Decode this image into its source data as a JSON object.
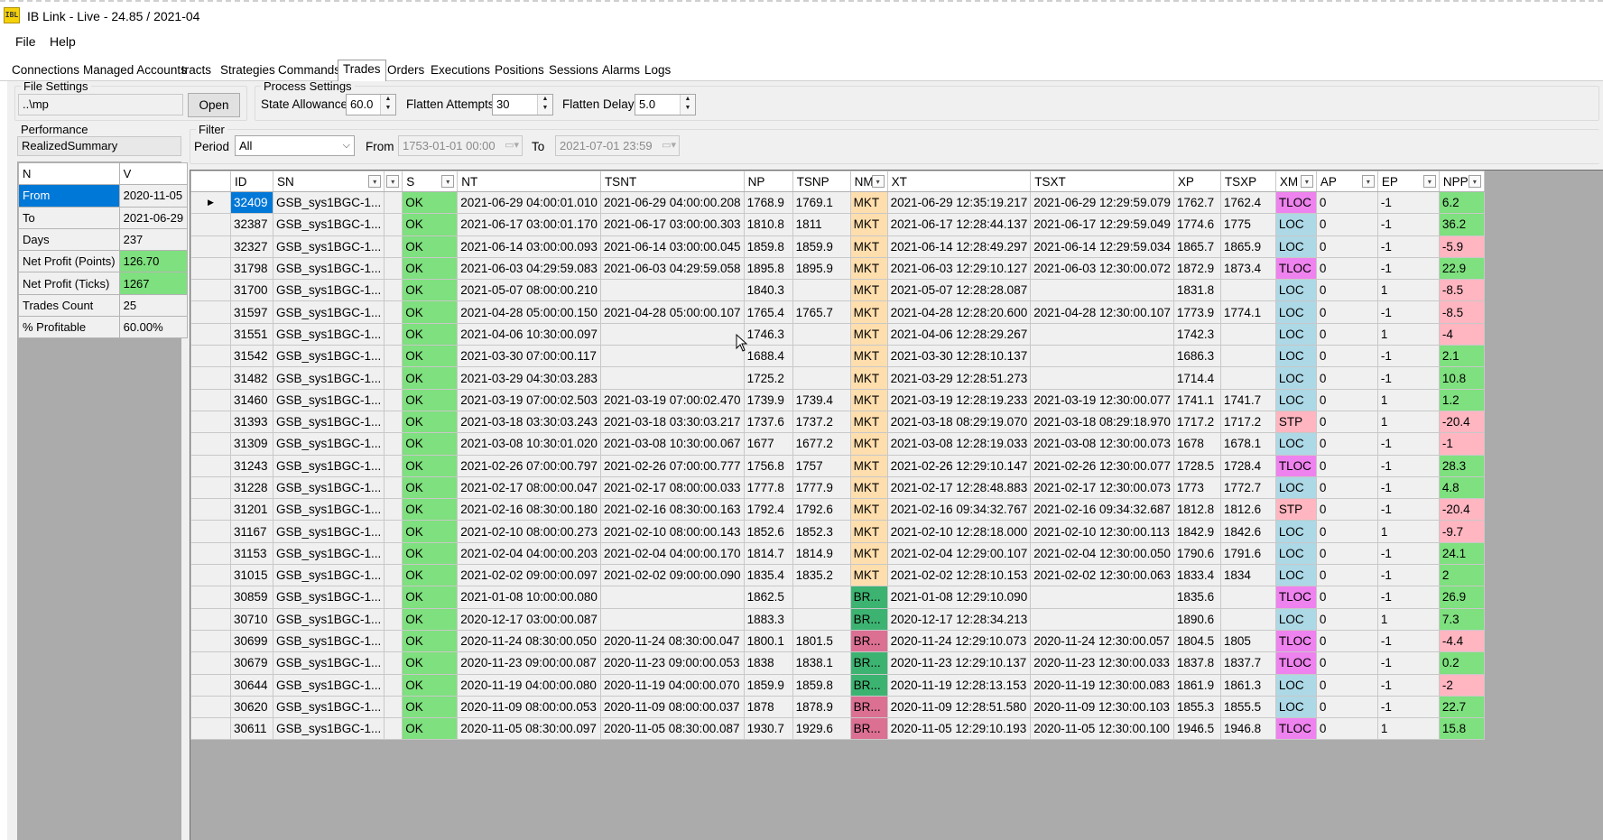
{
  "window": {
    "title": "IB Link - Live - 24.85 / 2021-04",
    "icon_text": "IBL"
  },
  "menu": [
    "File",
    "Help"
  ],
  "tabs": [
    "Connections",
    "Managed Accounts",
    "tracts",
    "Strategies",
    "Commands",
    "Trades",
    "Orders",
    "Executions",
    "Positions",
    "Sessions",
    "Alarms",
    "Logs"
  ],
  "selected_tab": "Trades",
  "file_settings": {
    "legend": "File Settings",
    "path": "..\\mp",
    "open_label": "Open"
  },
  "process_settings": {
    "legend": "Process Settings",
    "state_allowance_label": "State Allowance",
    "state_allowance": "60.0",
    "flatten_attempts_label": "Flatten Attempts",
    "flatten_attempts": "30",
    "flatten_delay_label": "Flatten Delay",
    "flatten_delay": "5.0"
  },
  "performance": {
    "legend": "Performance",
    "selector": "RealizedSummary",
    "headers": [
      "N",
      "V"
    ],
    "rows": [
      {
        "k": "From",
        "v": "2020-11-05"
      },
      {
        "k": "To",
        "v": "2021-06-29"
      },
      {
        "k": "Days",
        "v": "237"
      },
      {
        "k": "Net Profit (Points)",
        "v": "126.70"
      },
      {
        "k": "Net Profit (Ticks)",
        "v": "1267"
      },
      {
        "k": "Trades Count",
        "v": "25"
      },
      {
        "k": "% Profitable",
        "v": "60.00%"
      }
    ]
  },
  "filter": {
    "legend": "Filter",
    "period_label": "Period",
    "period_value": "All",
    "from_label": "From",
    "from_value": "1753-01-01 00:00",
    "to_label": "To",
    "to_value": "2021-07-01 23:59"
  },
  "grid": {
    "columns": [
      "ID",
      "SN",
      "",
      "S",
      "NT",
      "TSNT",
      "NP",
      "TSNP",
      "NM",
      "XT",
      "TSXT",
      "XP",
      "TSXP",
      "XM",
      "AP",
      "EP",
      "NPP"
    ],
    "rows": [
      [
        "32409",
        "GSB_sys1BGC-1...",
        "",
        "OK",
        "2021-06-29 04:00:01.010",
        "2021-06-29 04:00:00.208",
        "1768.9",
        "1769.1",
        "MKT",
        "2021-06-29 12:35:19.217",
        "2021-06-29 12:29:59.079",
        "1762.7",
        "1762.4",
        "TLOC",
        "0",
        "-1",
        "6.2"
      ],
      [
        "32387",
        "GSB_sys1BGC-1...",
        "",
        "OK",
        "2021-06-17 03:00:01.170",
        "2021-06-17 03:00:00.303",
        "1810.8",
        "1811",
        "MKT",
        "2021-06-17 12:28:44.137",
        "2021-06-17 12:29:59.049",
        "1774.6",
        "1775",
        "LOC",
        "0",
        "-1",
        "36.2"
      ],
      [
        "32327",
        "GSB_sys1BGC-1...",
        "",
        "OK",
        "2021-06-14 03:00:00.093",
        "2021-06-14 03:00:00.045",
        "1859.8",
        "1859.9",
        "MKT",
        "2021-06-14 12:28:49.297",
        "2021-06-14 12:29:59.034",
        "1865.7",
        "1865.9",
        "LOC",
        "0",
        "-1",
        "-5.9"
      ],
      [
        "31798",
        "GSB_sys1BGC-1...",
        "",
        "OK",
        "2021-06-03 04:29:59.083",
        "2021-06-03 04:29:59.058",
        "1895.8",
        "1895.9",
        "MKT",
        "2021-06-03 12:29:10.127",
        "2021-06-03 12:30:00.072",
        "1872.9",
        "1873.4",
        "TLOC",
        "0",
        "-1",
        "22.9"
      ],
      [
        "31700",
        "GSB_sys1BGC-1...",
        "",
        "OK",
        "2021-05-07 08:00:00.210",
        "",
        "1840.3",
        "",
        "MKT",
        "2021-05-07 12:28:28.087",
        "",
        "1831.8",
        "",
        "LOC",
        "0",
        "1",
        "-8.5"
      ],
      [
        "31597",
        "GSB_sys1BGC-1...",
        "",
        "OK",
        "2021-04-28 05:00:00.150",
        "2021-04-28 05:00:00.107",
        "1765.4",
        "1765.7",
        "MKT",
        "2021-04-28 12:28:20.600",
        "2021-04-28 12:30:00.107",
        "1773.9",
        "1774.1",
        "LOC",
        "0",
        "-1",
        "-8.5"
      ],
      [
        "31551",
        "GSB_sys1BGC-1...",
        "",
        "OK",
        "2021-04-06 10:30:00.097",
        "",
        "1746.3",
        "",
        "MKT",
        "2021-04-06 12:28:29.267",
        "",
        "1742.3",
        "",
        "LOC",
        "0",
        "1",
        "-4"
      ],
      [
        "31542",
        "GSB_sys1BGC-1...",
        "",
        "OK",
        "2021-03-30 07:00:00.117",
        "",
        "1688.4",
        "",
        "MKT",
        "2021-03-30 12:28:10.137",
        "",
        "1686.3",
        "",
        "LOC",
        "0",
        "-1",
        "2.1"
      ],
      [
        "31482",
        "GSB_sys1BGC-1...",
        "",
        "OK",
        "2021-03-29 04:30:03.283",
        "",
        "1725.2",
        "",
        "MKT",
        "2021-03-29 12:28:51.273",
        "",
        "1714.4",
        "",
        "LOC",
        "0",
        "-1",
        "10.8"
      ],
      [
        "31460",
        "GSB_sys1BGC-1...",
        "",
        "OK",
        "2021-03-19 07:00:02.503",
        "2021-03-19 07:00:02.470",
        "1739.9",
        "1739.4",
        "MKT",
        "2021-03-19 12:28:19.233",
        "2021-03-19 12:30:00.077",
        "1741.1",
        "1741.7",
        "LOC",
        "0",
        "1",
        "1.2"
      ],
      [
        "31393",
        "GSB_sys1BGC-1...",
        "",
        "OK",
        "2021-03-18 03:30:03.243",
        "2021-03-18 03:30:03.217",
        "1737.6",
        "1737.2",
        "MKT",
        "2021-03-18 08:29:19.070",
        "2021-03-18 08:29:18.970",
        "1717.2",
        "1717.2",
        "STP",
        "0",
        "1",
        "-20.4"
      ],
      [
        "31309",
        "GSB_sys1BGC-1...",
        "",
        "OK",
        "2021-03-08 10:30:01.020",
        "2021-03-08 10:30:00.067",
        "1677",
        "1677.2",
        "MKT",
        "2021-03-08 12:28:19.033",
        "2021-03-08 12:30:00.073",
        "1678",
        "1678.1",
        "LOC",
        "0",
        "-1",
        "-1"
      ],
      [
        "31243",
        "GSB_sys1BGC-1...",
        "",
        "OK",
        "2021-02-26 07:00:00.797",
        "2021-02-26 07:00:00.777",
        "1756.8",
        "1757",
        "MKT",
        "2021-02-26 12:29:10.147",
        "2021-02-26 12:30:00.077",
        "1728.5",
        "1728.4",
        "TLOC",
        "0",
        "-1",
        "28.3"
      ],
      [
        "31228",
        "GSB_sys1BGC-1...",
        "",
        "OK",
        "2021-02-17 08:00:00.047",
        "2021-02-17 08:00:00.033",
        "1777.8",
        "1777.9",
        "MKT",
        "2021-02-17 12:28:48.883",
        "2021-02-17 12:30:00.073",
        "1773",
        "1772.7",
        "LOC",
        "0",
        "-1",
        "4.8"
      ],
      [
        "31201",
        "GSB_sys1BGC-1...",
        "",
        "OK",
        "2021-02-16 08:30:00.180",
        "2021-02-16 08:30:00.163",
        "1792.4",
        "1792.6",
        "MKT",
        "2021-02-16 09:34:32.767",
        "2021-02-16 09:34:32.687",
        "1812.8",
        "1812.6",
        "STP",
        "0",
        "-1",
        "-20.4"
      ],
      [
        "31167",
        "GSB_sys1BGC-1...",
        "",
        "OK",
        "2021-02-10 08:00:00.273",
        "2021-02-10 08:00:00.143",
        "1852.6",
        "1852.3",
        "MKT",
        "2021-02-10 12:28:18.000",
        "2021-02-10 12:30:00.113",
        "1842.9",
        "1842.6",
        "LOC",
        "0",
        "1",
        "-9.7"
      ],
      [
        "31153",
        "GSB_sys1BGC-1...",
        "",
        "OK",
        "2021-02-04 04:00:00.203",
        "2021-02-04 04:00:00.170",
        "1814.7",
        "1814.9",
        "MKT",
        "2021-02-04 12:29:00.107",
        "2021-02-04 12:30:00.050",
        "1790.6",
        "1791.6",
        "LOC",
        "0",
        "-1",
        "24.1"
      ],
      [
        "31015",
        "GSB_sys1BGC-1...",
        "",
        "OK",
        "2021-02-02 09:00:00.097",
        "2021-02-02 09:00:00.090",
        "1835.4",
        "1835.2",
        "MKT",
        "2021-02-02 12:28:10.153",
        "2021-02-02 12:30:00.063",
        "1833.4",
        "1834",
        "LOC",
        "0",
        "-1",
        "2"
      ],
      [
        "30859",
        "GSB_sys1BGC-1...",
        "",
        "OK",
        "2021-01-08 10:00:00.080",
        "",
        "1862.5",
        "",
        "BR...",
        "2021-01-08 12:29:10.090",
        "",
        "1835.6",
        "",
        "TLOC",
        "0",
        "-1",
        "26.9"
      ],
      [
        "30710",
        "GSB_sys1BGC-1...",
        "",
        "OK",
        "2020-12-17 03:00:00.087",
        "",
        "1883.3",
        "",
        "BR...",
        "2020-12-17 12:28:34.213",
        "",
        "1890.6",
        "",
        "LOC",
        "0",
        "1",
        "7.3"
      ],
      [
        "30699",
        "GSB_sys1BGC-1...",
        "",
        "OK",
        "2020-11-24 08:30:00.050",
        "2020-11-24 08:30:00.047",
        "1800.1",
        "1801.5",
        "BR...",
        "2020-11-24 12:29:10.073",
        "2020-11-24 12:30:00.057",
        "1804.5",
        "1805",
        "TLOC",
        "0",
        "-1",
        "-4.4"
      ],
      [
        "30679",
        "GSB_sys1BGC-1...",
        "",
        "OK",
        "2020-11-23 09:00:00.087",
        "2020-11-23 09:00:00.053",
        "1838",
        "1838.1",
        "BR...",
        "2020-11-23 12:29:10.137",
        "2020-11-23 12:30:00.033",
        "1837.8",
        "1837.7",
        "TLOC",
        "0",
        "-1",
        "0.2"
      ],
      [
        "30644",
        "GSB_sys1BGC-1...",
        "",
        "OK",
        "2020-11-19 04:00:00.080",
        "2020-11-19 04:00:00.070",
        "1859.9",
        "1859.8",
        "BR...",
        "2020-11-19 12:28:13.153",
        "2020-11-19 12:30:00.083",
        "1861.9",
        "1861.3",
        "LOC",
        "0",
        "-1",
        "-2"
      ],
      [
        "30620",
        "GSB_sys1BGC-1...",
        "",
        "OK",
        "2020-11-09 08:00:00.053",
        "2020-11-09 08:00:00.037",
        "1878",
        "1878.9",
        "BR...",
        "2020-11-09 12:28:51.580",
        "2020-11-09 12:30:00.103",
        "1855.3",
        "1855.5",
        "LOC",
        "0",
        "-1",
        "22.7"
      ],
      [
        "30611",
        "GSB_sys1BGC-1...",
        "",
        "OK",
        "2020-11-05 08:30:00.097",
        "2020-11-05 08:30:00.087",
        "1930.7",
        "1929.6",
        "BR...",
        "2020-11-05 12:29:10.193",
        "2020-11-05 12:30:00.100",
        "1946.5",
        "1946.8",
        "TLOC",
        "0",
        "1",
        "15.8"
      ]
    ],
    "nm_colors": {
      "MKT": "#ffdead",
      "BR_long": "#3cb371",
      "BR_short": "#db7093"
    },
    "br_direction": [
      "",
      "",
      "",
      "",
      "",
      "",
      "",
      "",
      "",
      "",
      "",
      "",
      "",
      "",
      "",
      "",
      "",
      "",
      "long",
      "long",
      "short",
      "long",
      "long",
      "short",
      "short"
    ]
  },
  "colors": {
    "ok": "#7ee07e",
    "loc": "#add8e6",
    "tloc": "#ee82ee",
    "stp": "#ffb6c1",
    "profit": "#7ee07e",
    "loss": "#ffb6c1",
    "selected": "#0078d7"
  }
}
